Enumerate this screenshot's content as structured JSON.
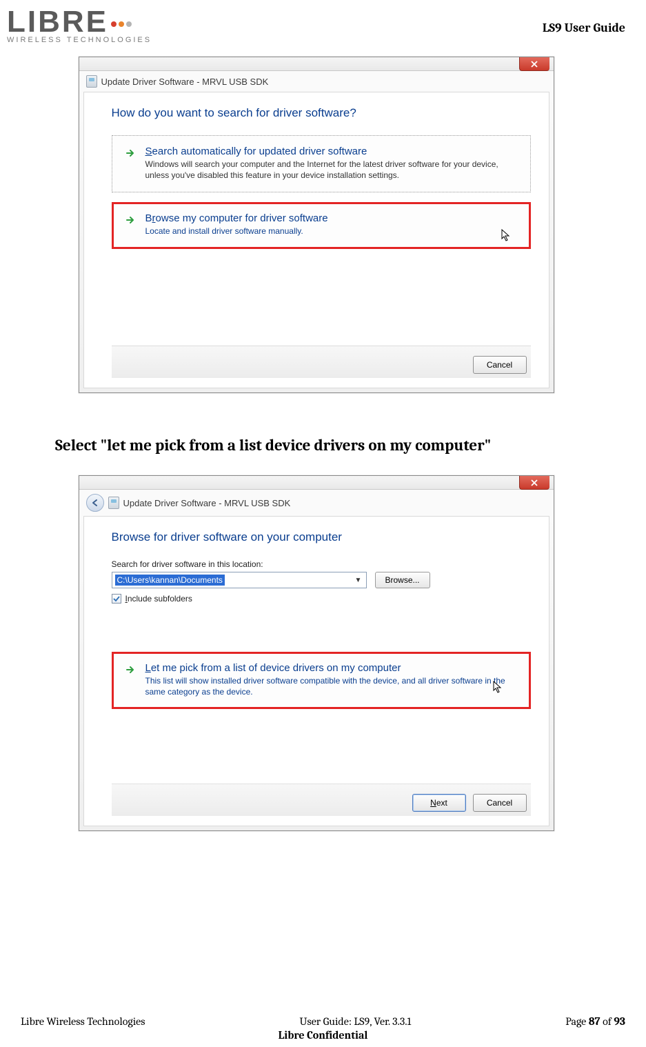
{
  "header": {
    "logo_text": "LIBRE",
    "logo_sub": "WIRELESS TECHNOLOGIES",
    "dot_colors": [
      "#d63f2e",
      "#e9842c",
      "#b4b4b4"
    ],
    "doc_title": "LS9 User Guide"
  },
  "dialog1": {
    "window_title": "Update Driver Software - MRVL USB SDK",
    "heading": "How do you want to search for driver software?",
    "option_a": {
      "title": "Search automatically for updated driver software",
      "desc": "Windows will search your computer and the Internet for the latest driver software for your device, unless you've disabled this feature in your device installation settings."
    },
    "option_b": {
      "title": "Browse my computer for driver software",
      "desc": "Locate and install driver software manually."
    },
    "cancel": "Cancel"
  },
  "instruction": "Select \"let me pick from a list device drivers on my computer\"",
  "dialog2": {
    "window_title": "Update Driver Software - MRVL USB SDK",
    "heading": "Browse for driver software on your computer",
    "search_label": "Search for driver software in this location:",
    "path_value": "C:\\Users\\kannan\\Documents",
    "browse_btn": "Browse...",
    "include_label": "Include subfolders",
    "option": {
      "title": "Let me pick from a list of device drivers on my computer",
      "desc": "This list will show installed driver software compatible with the device, and all driver software in the same category as the device."
    },
    "next": "Next",
    "cancel": "Cancel"
  },
  "footer": {
    "left": "Libre Wireless Technologies",
    "center": "User Guide: LS9, Ver. 3.3.1",
    "right_pre": "Page ",
    "page_cur": "87",
    "right_mid": " of ",
    "page_total": "93",
    "confidential": "Libre Confidential"
  }
}
